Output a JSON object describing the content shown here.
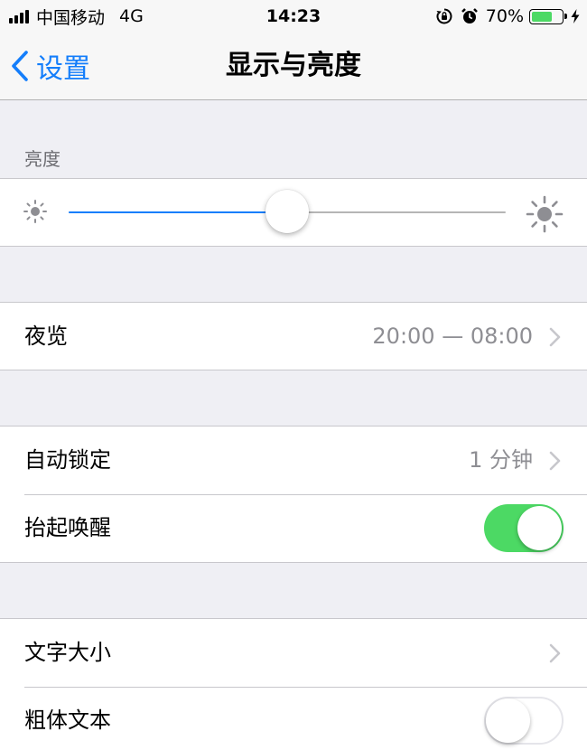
{
  "status_bar": {
    "carrier": "中国移动",
    "network": "4G",
    "time": "14:23",
    "battery_percent_label": "70%",
    "battery_level": 0.7,
    "icons": [
      "signal-icon",
      "rotation-lock-icon",
      "alarm-icon",
      "battery-icon",
      "charging-bolt-icon"
    ]
  },
  "nav": {
    "back_label": "设置",
    "title": "显示与亮度"
  },
  "brightness": {
    "section_header": "亮度",
    "level": 0.5
  },
  "rows": {
    "night_shift": {
      "label": "夜览",
      "value": "20:00 — 08:00"
    },
    "auto_lock": {
      "label": "自动锁定",
      "value": "1 分钟"
    },
    "raise_to_wake": {
      "label": "抬起唤醒",
      "on": true
    },
    "text_size": {
      "label": "文字大小"
    },
    "bold_text": {
      "label": "粗体文本",
      "on": false
    }
  },
  "colors": {
    "accent": "#147efb",
    "toggle_on": "#4cd964",
    "background": "#efeff4",
    "secondary_text": "#8e8e93"
  }
}
